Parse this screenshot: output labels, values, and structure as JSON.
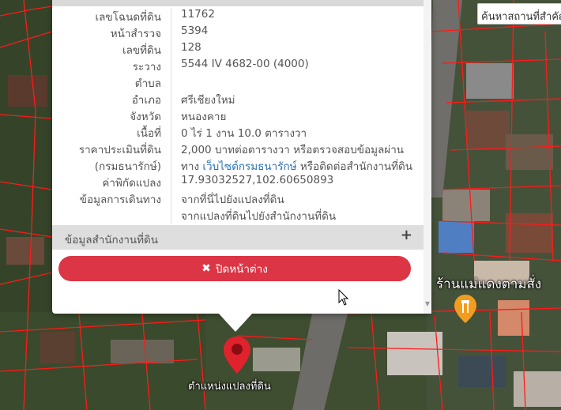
{
  "search": {
    "label": "ค้นหาสถานที่สำคัญ"
  },
  "popup": {
    "rows": [
      {
        "key": "เลขโฉนดที่ดิน",
        "value": "11762"
      },
      {
        "key": "หน้าสำรวจ",
        "value": "5394"
      },
      {
        "key": "เลขที่ดิน",
        "value": "128"
      },
      {
        "key": "ระวาง",
        "value": "5544 IV 4682-00 (4000)"
      },
      {
        "key": "ตำบล",
        "value": ""
      },
      {
        "key": "อำเภอ",
        "value": "ศรีเชียงใหม่"
      },
      {
        "key": "จังหวัด",
        "value": "หนองคาย"
      },
      {
        "key": "เนื้อที่",
        "value": "0 ไร่ 1 งาน 10.0 ตารางวา"
      },
      {
        "key": "ราคาประเมินที่ดิน",
        "value": "2,000 บาทต่อตารางวา หรือตรวจสอบข้อมูลผ่าน"
      },
      {
        "key": "(กรมธนารักษ์)",
        "value_pre": "ทาง ",
        "value_link": "เว็บไซต์กรมธนารักษ์",
        "value_post": " หรือติดต่อสำนักงานที่ดิน"
      },
      {
        "key": "ค่าพิกัดแปลง",
        "value": "17.93032527,102.60650893"
      },
      {
        "key": "ข้อมูลการเดินทาง",
        "value": "จากที่นี่ไปยังแปลงที่ดิน"
      },
      {
        "key": "",
        "value": "จากแปลงที่ดินไปยังสำนักงานที่ดิน"
      }
    ],
    "office_section": {
      "label": "ข้อมูลสำนักงานที่ดิน",
      "expand_icon": "+"
    },
    "close_button": {
      "icon": "✖",
      "label": "ปิดหน้าต่าง"
    }
  },
  "map": {
    "marker_label": "ตำแหน่งแปลงที่ดิน",
    "place_label": "ร้านแม่แดงตามสั่ง"
  },
  "colors": {
    "danger": "#dc3545",
    "link": "#2a73b8",
    "marker": "#e0222d",
    "parcel_line": "#ff1a1a"
  }
}
